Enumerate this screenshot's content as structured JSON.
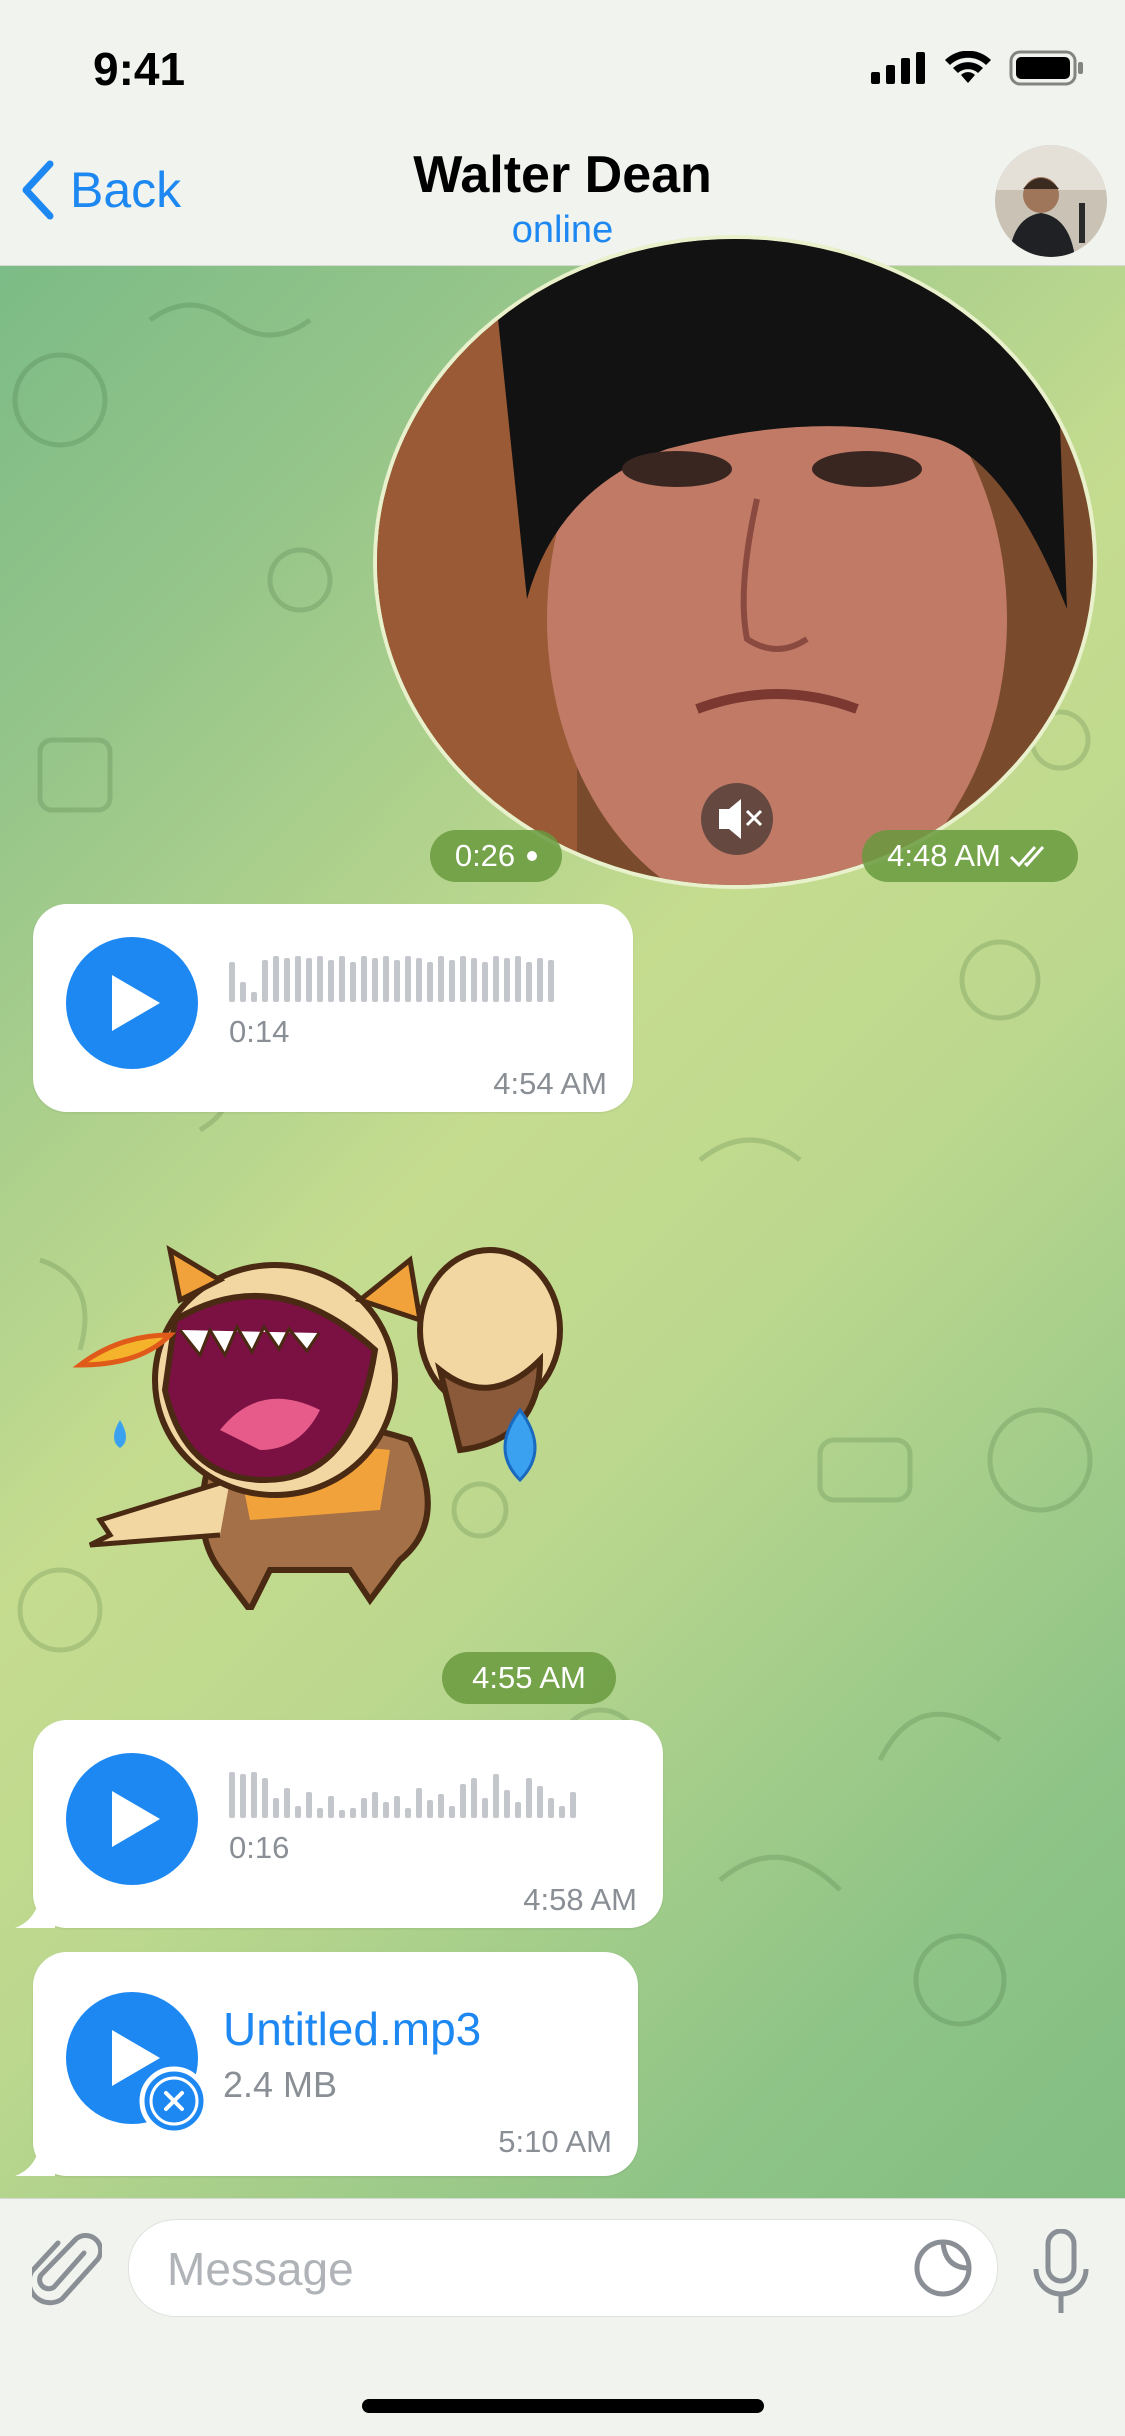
{
  "status_bar": {
    "time": "9:41"
  },
  "header": {
    "back_label": "Back",
    "contact_name": "Walter Dean",
    "contact_status": "online"
  },
  "messages": [
    {
      "type": "round-video",
      "duration": "0:26",
      "time": "4:48 AM"
    },
    {
      "type": "voice",
      "duration": "0:14",
      "time": "4:54 AM"
    },
    {
      "type": "sticker",
      "time": "4:55 AM"
    },
    {
      "type": "voice",
      "duration": "0:16",
      "time": "4:58 AM"
    },
    {
      "type": "file",
      "file_name": "Untitled.mp3",
      "file_size": "2.4 MB",
      "time": "5:10 AM"
    }
  ],
  "composer": {
    "placeholder": "Message"
  },
  "colors": {
    "accent": "#1e88f2",
    "bubble": "#ffffff",
    "time_pill": "#689a3e"
  }
}
